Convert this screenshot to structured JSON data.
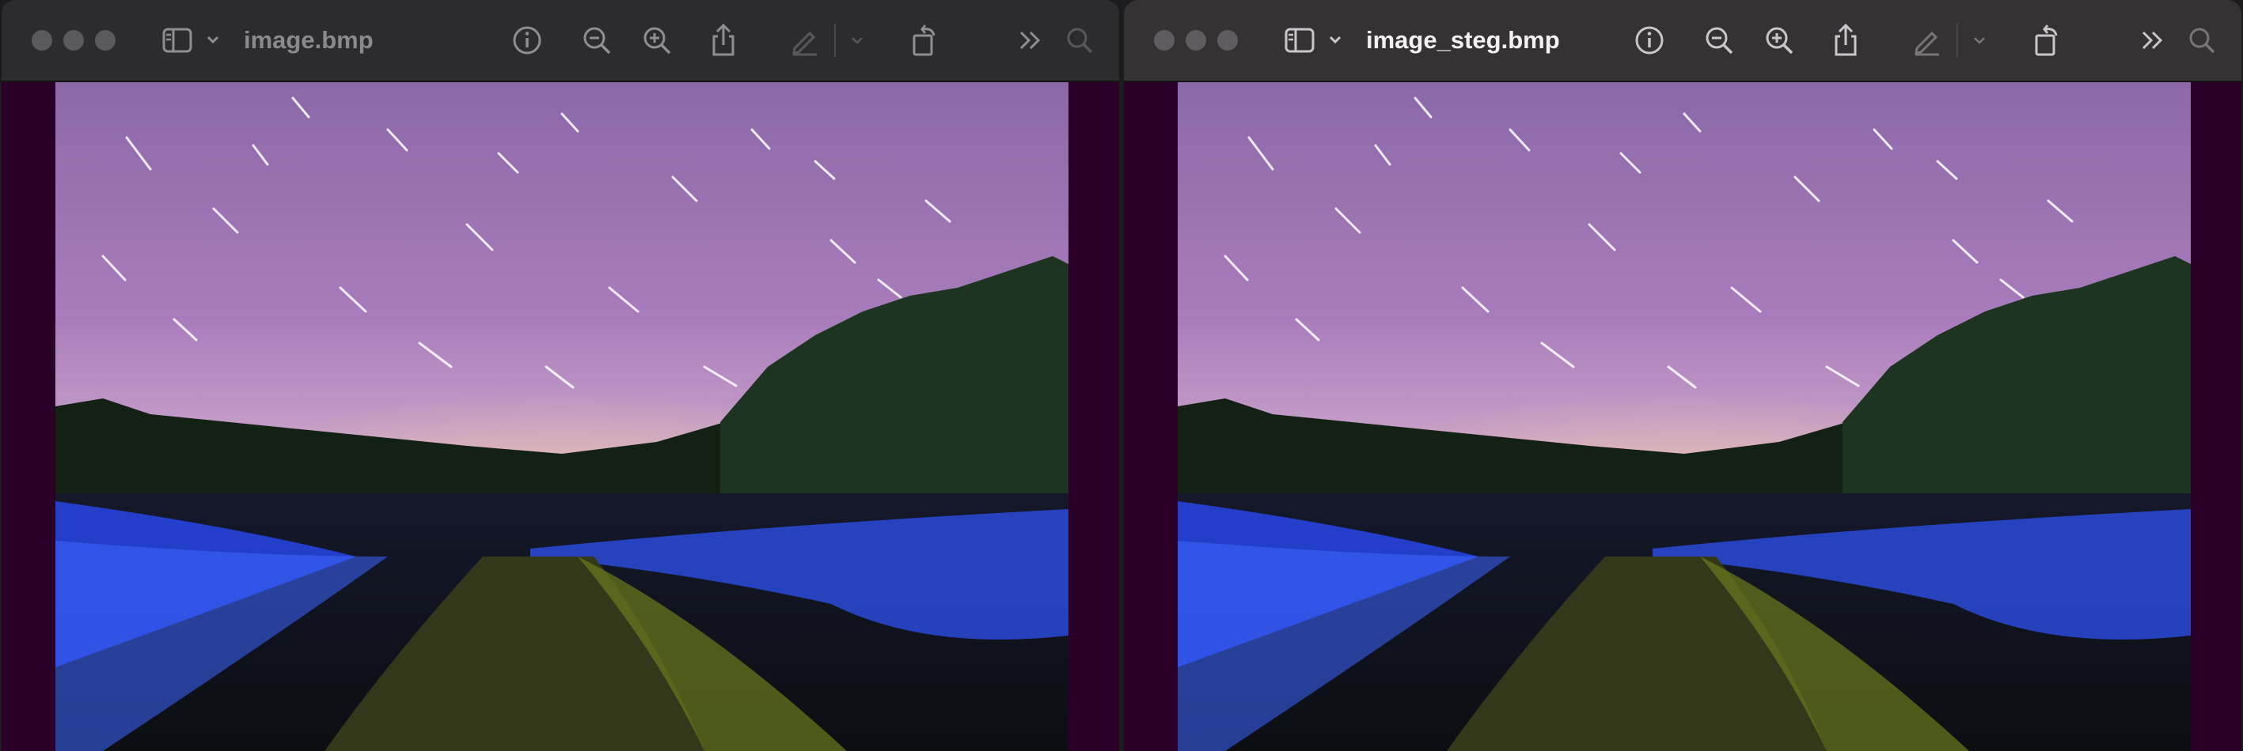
{
  "windows": [
    {
      "id": "left",
      "title": "image.bmp",
      "toolbar": {
        "sidebar_icon": "sidebar-toggle-icon",
        "info_icon": "info-icon",
        "zoom_out_icon": "zoom-out-icon",
        "zoom_in_icon": "zoom-in-icon",
        "share_icon": "share-icon",
        "markup_icon": "markup-pencil-icon",
        "rotate_icon": "rotate-icon",
        "more_icon": "chevron-double-right-icon",
        "search_icon": "search-icon"
      },
      "image_description": "Night sky with star trails over a field lit by blue light painting",
      "focused": false
    },
    {
      "id": "right",
      "title": "image_steg.bmp",
      "toolbar": {
        "sidebar_icon": "sidebar-toggle-icon",
        "info_icon": "info-icon",
        "zoom_out_icon": "zoom-out-icon",
        "zoom_in_icon": "zoom-in-icon",
        "share_icon": "share-icon",
        "markup_icon": "markup-pencil-icon",
        "rotate_icon": "rotate-icon",
        "more_icon": "chevron-double-right-icon",
        "search_icon": "search-icon"
      },
      "image_description": "Night sky with star trails over a field lit by blue light painting",
      "focused": true
    }
  ],
  "colors": {
    "window_background": "#2a0029",
    "titlebar_inactive": "#2c2c2e",
    "titlebar_active": "#363234",
    "icon_inactive": "#8e8e93",
    "icon_active": "#c8c8cc",
    "light_painting_blue": "#3a5cff",
    "sky_purple": "#a678b8"
  }
}
